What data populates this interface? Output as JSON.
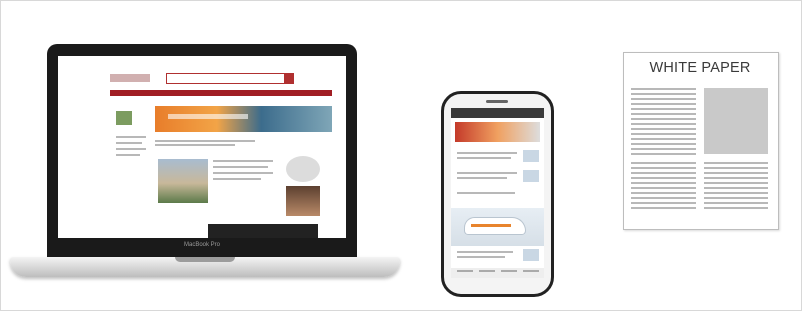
{
  "laptop": {
    "label": "MacBook Pro"
  },
  "white_paper": {
    "title": "WHITE PAPER"
  },
  "colors": {
    "site_accent": "#a11e24",
    "paper_gray": "#c9c9c9",
    "device_black": "#1a1a1a"
  }
}
